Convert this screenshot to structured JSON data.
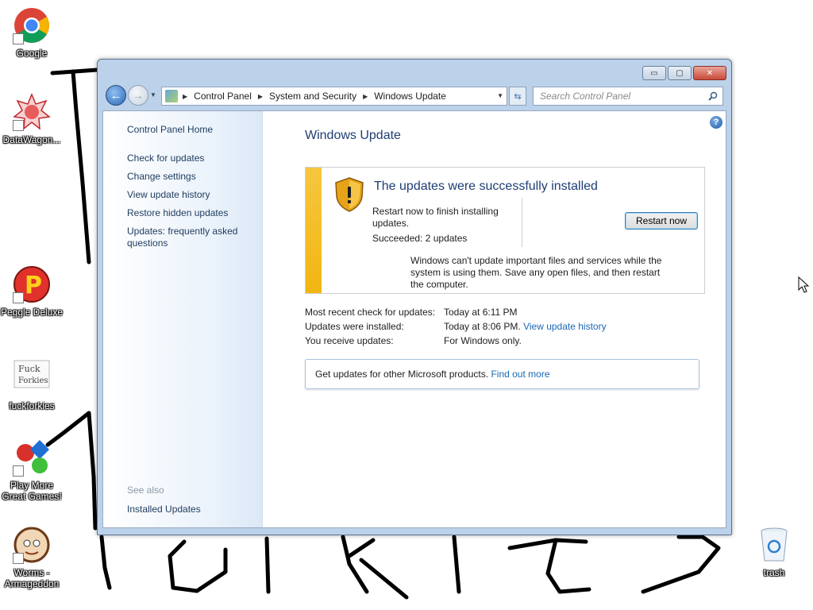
{
  "desktop": {
    "icons": [
      {
        "label": "Google"
      },
      {
        "label": "DataWagon..."
      },
      {
        "label": "Peggle Deluxe"
      },
      {
        "label": "fuckforkies",
        "image_text": "Fuck Forkies"
      },
      {
        "label": "Play More Great Games!"
      },
      {
        "label": "Worms - Armageddon"
      },
      {
        "label": "trash"
      }
    ]
  },
  "window": {
    "caption_buttons": {
      "minimize": "▭",
      "maximize": "▢",
      "close": "✕"
    },
    "address": {
      "crumbs": [
        "Control Panel",
        "System and Security",
        "Windows Update"
      ]
    },
    "search": {
      "placeholder": "Search Control Panel"
    },
    "left_pane": {
      "home": "Control Panel Home",
      "links": [
        "Check for updates",
        "Change settings",
        "View update history",
        "Restore hidden updates",
        "Updates: frequently asked questions"
      ],
      "see_also": "See also",
      "see_also_links": [
        "Installed Updates"
      ]
    },
    "main": {
      "title": "Windows Update",
      "status": {
        "heading": "The updates were successfully installed",
        "description": "Restart now to finish installing updates.",
        "succeeded": "Succeeded: 2 updates",
        "button": "Restart now",
        "warning": "Windows can't update important files and services while the system is using them. Save any open files, and then restart the computer."
      },
      "info": {
        "recent_check_label": "Most recent check for updates:",
        "recent_check_value": "Today at 6:11 PM",
        "installed_label": "Updates were installed:",
        "installed_value": "Today at 8:06 PM.",
        "installed_link": "View update history",
        "receive_label": "You receive updates:",
        "receive_value": "For Windows only."
      },
      "get_updates": {
        "text": "Get updates for other Microsoft products.",
        "link": "Find out more"
      }
    }
  },
  "colors": {
    "accent_title": "#1e3e73",
    "link": "#1b67b4",
    "status_strip": "#f2b612"
  }
}
